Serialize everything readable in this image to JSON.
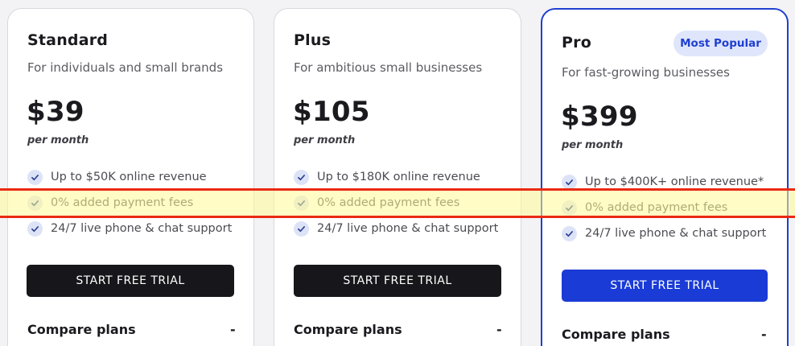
{
  "colors": {
    "page_bg": "#f3f2f5",
    "dark_button": "#17171b",
    "pro_accent": "#1a3bd6",
    "badge_bg": "#dfe6fb",
    "highlight_band": "#fffc96",
    "highlight_border": "#ea2a14"
  },
  "icons": {
    "feature_check": "check-icon"
  },
  "plans": [
    {
      "name": "Standard",
      "description": "For individuals and small brands",
      "price": "$39",
      "period": "per month",
      "features": [
        "Up to $50K online revenue",
        "0% added payment fees",
        "24/7 live phone & chat support"
      ],
      "cta": "START FREE TRIAL",
      "compare": "Compare plans",
      "toggle": "-"
    },
    {
      "name": "Plus",
      "description": "For ambitious small businesses",
      "price": "$105",
      "period": "per month",
      "features": [
        "Up to $180K online revenue",
        "0% added payment fees",
        "24/7 live phone & chat support"
      ],
      "cta": "START FREE TRIAL",
      "compare": "Compare plans",
      "toggle": "-"
    },
    {
      "name": "Pro",
      "badge": "Most Popular",
      "description": "For fast-growing businesses",
      "price": "$399",
      "period": "per month",
      "features": [
        "Up to $400K+ online revenue*",
        "0% added payment fees",
        "24/7 live phone & chat support"
      ],
      "cta": "START FREE TRIAL",
      "compare": "Compare plans",
      "toggle": "-"
    }
  ]
}
